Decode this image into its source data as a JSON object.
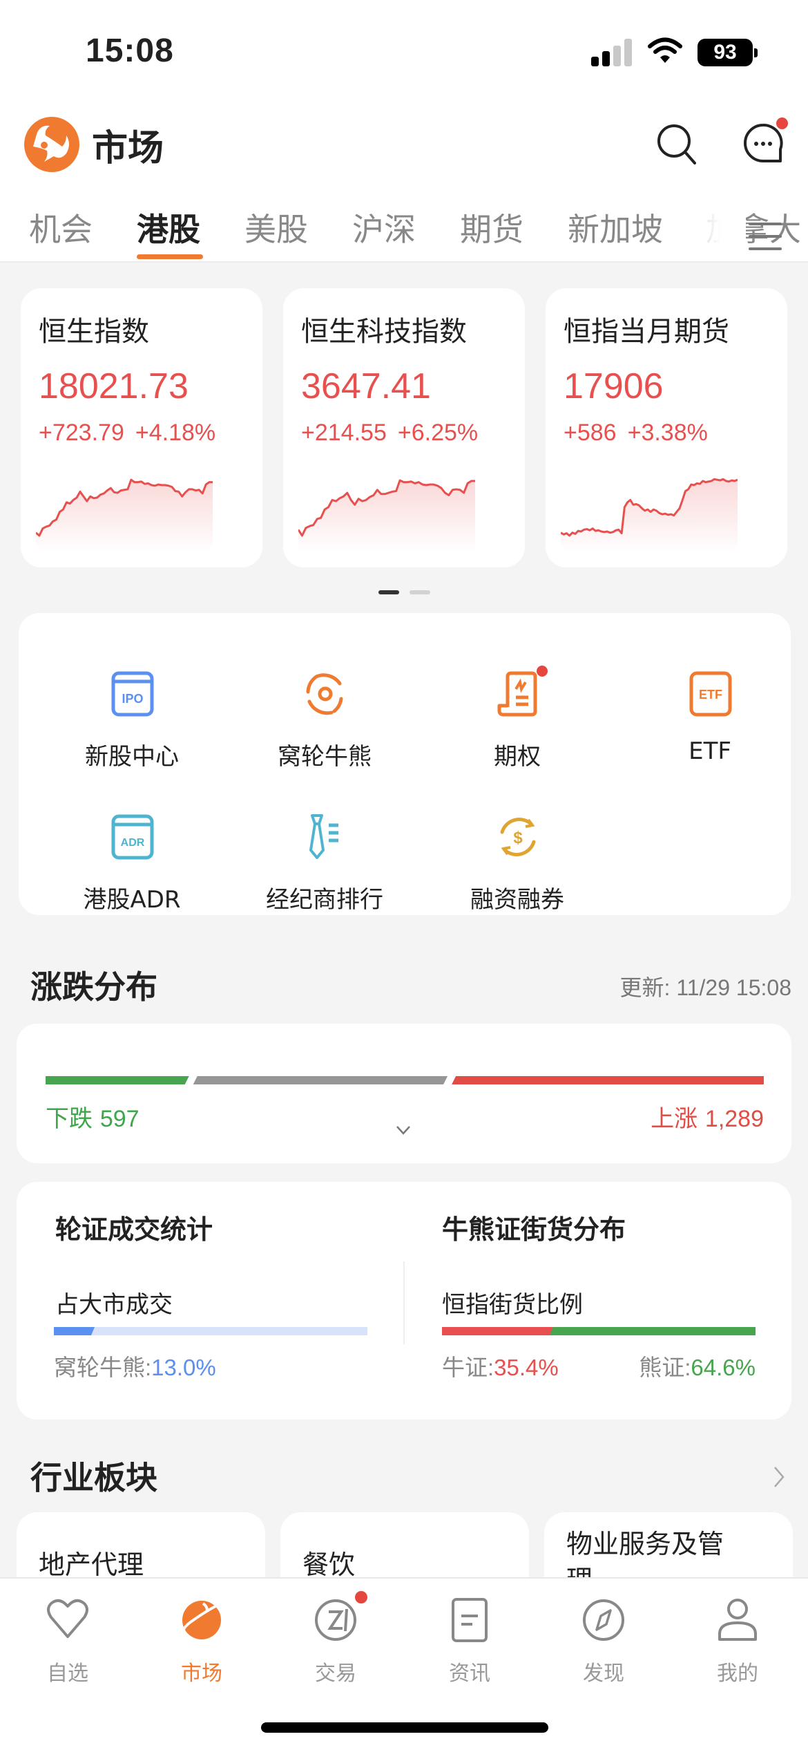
{
  "status_bar": {
    "time": "15:08",
    "battery": "93"
  },
  "header": {
    "title": "市场",
    "has_message_badge": true
  },
  "tabs": [
    {
      "label": "机会",
      "active": false
    },
    {
      "label": "港股",
      "active": true
    },
    {
      "label": "美股",
      "active": false
    },
    {
      "label": "沪深",
      "active": false
    },
    {
      "label": "期货",
      "active": false
    },
    {
      "label": "新加坡",
      "active": false
    },
    {
      "label": "加拿大",
      "active": false
    }
  ],
  "colors": {
    "accent": "#ef7a30",
    "up": "#e8504f",
    "down": "#3fa64b",
    "neutral": "#969696",
    "blue": "#5b8ff0"
  },
  "index_cards": [
    {
      "name": "恒生指数",
      "price": "18021.73",
      "change": "+723.79",
      "change_pct": "+4.18%",
      "sparkline": [
        0.05,
        0.0,
        0.12,
        0.15,
        0.17,
        0.24,
        0.27,
        0.4,
        0.44,
        0.56,
        0.54,
        0.6,
        0.64,
        0.74,
        0.66,
        0.58,
        0.66,
        0.63,
        0.64,
        0.69,
        0.71,
        0.76,
        0.8,
        0.73,
        0.72,
        0.76,
        0.77,
        0.78,
        0.94,
        0.9,
        0.9,
        0.91,
        0.87,
        0.88,
        0.85,
        0.84,
        0.86,
        0.85,
        0.85,
        0.84,
        0.82,
        0.75,
        0.74,
        0.66,
        0.73,
        0.78,
        0.78,
        0.76,
        0.77,
        0.71,
        0.86,
        0.9,
        0.9
      ]
    },
    {
      "name": "恒生科技指数",
      "price": "3647.41",
      "change": "+214.55",
      "change_pct": "+6.25%",
      "sparkline": [
        0.1,
        0.0,
        0.13,
        0.16,
        0.18,
        0.28,
        0.3,
        0.44,
        0.48,
        0.6,
        0.58,
        0.63,
        0.66,
        0.72,
        0.6,
        0.52,
        0.62,
        0.58,
        0.6,
        0.65,
        0.68,
        0.77,
        0.7,
        0.7,
        0.72,
        0.74,
        0.75,
        0.93,
        0.9,
        0.9,
        0.91,
        0.88,
        0.9,
        0.86,
        0.85,
        0.86,
        0.86,
        0.84,
        0.8,
        0.72,
        0.68,
        0.77,
        0.78,
        0.77,
        0.72,
        0.88,
        0.92,
        0.92
      ]
    },
    {
      "name": "恒指当月期货",
      "price": "17906",
      "change": "+586",
      "change_pct": "+3.38%",
      "sparkline": [
        0.05,
        0.02,
        0.04,
        0.0,
        0.05,
        0.03,
        0.08,
        0.07,
        0.1,
        0.11,
        0.09,
        0.12,
        0.08,
        0.09,
        0.07,
        0.06,
        0.07,
        0.05,
        0.06,
        0.09,
        0.1,
        0.04,
        0.48,
        0.56,
        0.6,
        0.52,
        0.53,
        0.51,
        0.46,
        0.42,
        0.44,
        0.4,
        0.44,
        0.42,
        0.38,
        0.36,
        0.37,
        0.35,
        0.36,
        0.34,
        0.4,
        0.46,
        0.6,
        0.75,
        0.78,
        0.86,
        0.85,
        0.88,
        0.87,
        0.92,
        0.9,
        0.91,
        0.92,
        0.95,
        0.94,
        0.93,
        0.95,
        0.92,
        0.91,
        0.93,
        0.92,
        0.94
      ]
    }
  ],
  "pager": {
    "pages": 2,
    "current": 0
  },
  "quick_grid": [
    {
      "label": "新股中心",
      "icon": "ipo-icon",
      "color": "#5b8ff0",
      "badge": false
    },
    {
      "label": "窝轮牛熊",
      "icon": "warrant-icon",
      "color": "#ef7a30",
      "badge": false
    },
    {
      "label": "期权",
      "icon": "options-icon",
      "color": "#ef7a30",
      "badge": true
    },
    {
      "label": "ETF",
      "icon": "etf-icon",
      "color": "#ef7a30",
      "badge": false
    },
    {
      "label": "港股ADR",
      "icon": "adr-icon",
      "color": "#4fb4cf",
      "badge": false
    },
    {
      "label": "经纪商排行",
      "icon": "broker-tie-icon",
      "color": "#4fb4cf",
      "badge": false
    },
    {
      "label": "融资融券",
      "icon": "margin-dollar-icon",
      "color": "#e0a530",
      "badge": false
    }
  ],
  "distribution": {
    "title": "涨跌分布",
    "updated": "更新: 11/29 15:08",
    "down_label": "下跌",
    "down_count": "597",
    "up_label": "上涨",
    "up_count": "1,289",
    "down": 597,
    "up": 1289,
    "flat_share": 0.36
  },
  "warrant_stats": {
    "left": {
      "title": "轮证成交统计",
      "subtitle": "占大市成交",
      "foot_label": "窝轮牛熊:",
      "foot_value": "13.0%",
      "share": 0.13
    },
    "right": {
      "title": "牛熊证街货分布",
      "subtitle": "恒指街货比例",
      "bull_label": "牛证:",
      "bull_value": "35.4%",
      "bear_label": "熊证:",
      "bear_value": "64.6%",
      "bull_share": 0.354
    }
  },
  "sectors": {
    "title": "行业板块",
    "items": [
      {
        "name": "地产代理"
      },
      {
        "name": "餐饮"
      },
      {
        "name": "物业服务及管理"
      }
    ]
  },
  "tabbar": [
    {
      "label": "自选",
      "icon": "heart-icon",
      "active": false,
      "badge": false
    },
    {
      "label": "市场",
      "icon": "planet-icon",
      "active": true,
      "badge": false
    },
    {
      "label": "交易",
      "icon": "trade-icon",
      "active": false,
      "badge": true
    },
    {
      "label": "资讯",
      "icon": "news-icon",
      "active": false,
      "badge": false
    },
    {
      "label": "发现",
      "icon": "compass-icon",
      "active": false,
      "badge": false
    },
    {
      "label": "我的",
      "icon": "profile-icon",
      "active": false,
      "badge": false
    }
  ]
}
